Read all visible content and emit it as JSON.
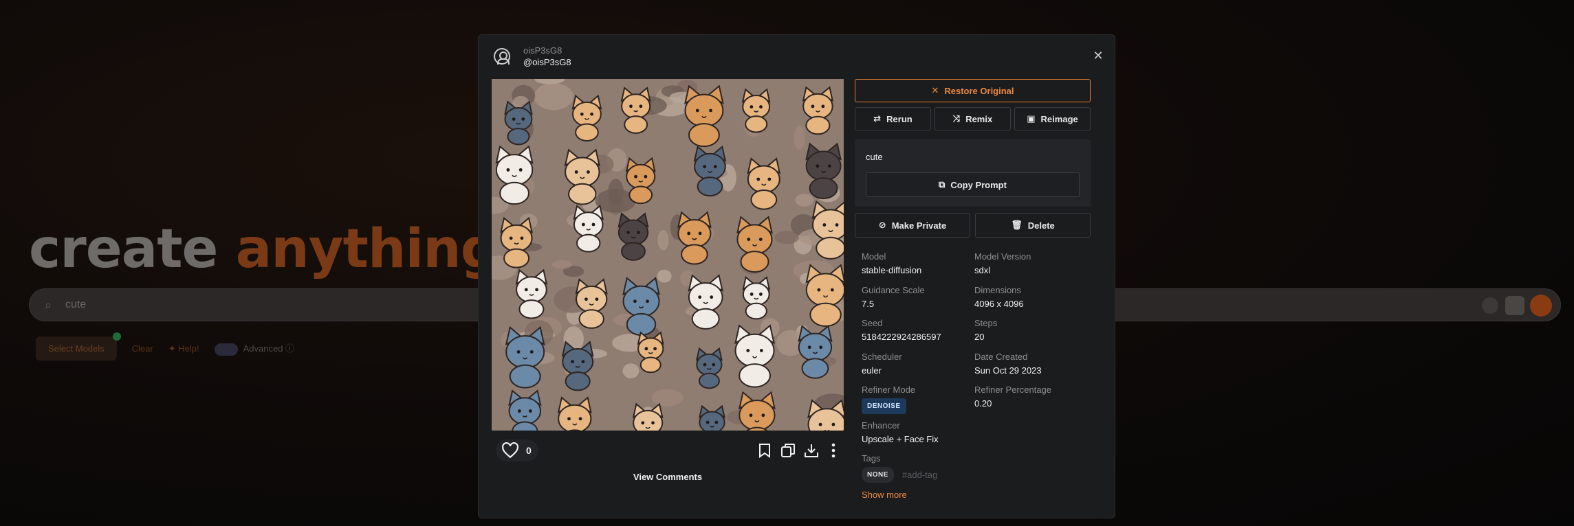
{
  "background": {
    "hero_word_1": "create",
    "hero_word_2": "anything",
    "search_text": "cute",
    "toolbar": {
      "select_models": "Select Models",
      "clear": "Clear",
      "help": "Help!",
      "advanced": "Advanced"
    }
  },
  "modal": {
    "user": {
      "name": "oisP3sG8",
      "handle": "@oisP3sG8"
    },
    "close_icon": "close-icon",
    "image_actions": {
      "like_count": "0",
      "icons": [
        "heart-icon",
        "bookmark-icon",
        "copy-icon",
        "download-icon",
        "more-vertical-icon"
      ]
    },
    "view_comments": "View Comments",
    "buttons": {
      "restore": "Restore Original",
      "rerun": "Rerun",
      "remix": "Remix",
      "reimage": "Reimage",
      "copy_prompt": "Copy Prompt",
      "make_private": "Make Private",
      "delete": "Delete"
    },
    "prompt": "cute",
    "details": {
      "model_label": "Model",
      "model": "stable-diffusion",
      "model_version_label": "Model Version",
      "model_version": "sdxl",
      "guidance_label": "Guidance Scale",
      "guidance": "7.5",
      "dimensions_label": "Dimensions",
      "dimensions": "4096 x 4096",
      "seed_label": "Seed",
      "seed": "5184222924286597",
      "steps_label": "Steps",
      "steps": "20",
      "scheduler_label": "Scheduler",
      "scheduler": "euler",
      "date_label": "Date Created",
      "date": "Sun Oct 29 2023",
      "refiner_mode_label": "Refiner Mode",
      "refiner_mode": "DENOISE",
      "refiner_pct_label": "Refiner Percentage",
      "refiner_pct": "0.20",
      "enhancer_label": "Enhancer",
      "enhancer": "Upscale + Face Fix",
      "tags_label": "Tags",
      "tag_none": "NONE",
      "tag_placeholder": "#add-tag"
    },
    "show_more": "Show more",
    "accent_color": "#ee8a3c"
  }
}
